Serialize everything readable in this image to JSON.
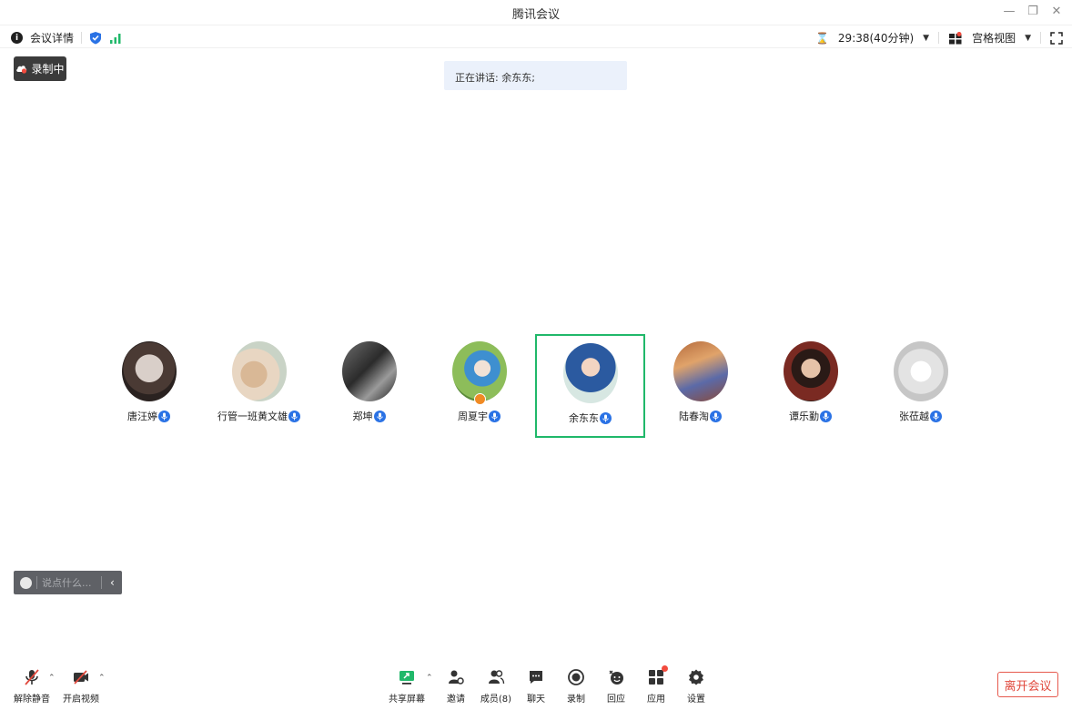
{
  "window": {
    "title": "腾讯会议",
    "controls": [
      "—",
      "❐",
      "✕"
    ]
  },
  "infobar": {
    "meeting_details": "会议详情",
    "timer": "29:38(40分钟)",
    "view_label": "宫格视图"
  },
  "recording_badge": "录制中",
  "speaking_banner": "正在讲话: 余东东;",
  "participants": [
    {
      "name": "唐汪婷",
      "active": false
    },
    {
      "name": "行管一班黄文雄",
      "active": false
    },
    {
      "name": "郑坤",
      "active": false
    },
    {
      "name": "周夏宇",
      "active": false,
      "host": true
    },
    {
      "name": "余东东",
      "active": true
    },
    {
      "name": "陆春淘",
      "active": false
    },
    {
      "name": "谭乐勤",
      "active": false
    },
    {
      "name": "张莅越",
      "active": false
    }
  ],
  "chat": {
    "placeholder": "说点什么..."
  },
  "toolbar": {
    "unmute": "解除静音",
    "start_video": "开启视频",
    "share_screen": "共享屏幕",
    "invite": "邀请",
    "members": "成员(8)",
    "chat": "聊天",
    "record": "录制",
    "react": "回应",
    "apps": "应用",
    "settings": "设置",
    "leave": "离开会议"
  },
  "colors": {
    "active_border": "#20b86a",
    "mic_blue": "#2a72e5",
    "leave_red": "#e0483c",
    "banner_bg": "#ebf1fb"
  }
}
